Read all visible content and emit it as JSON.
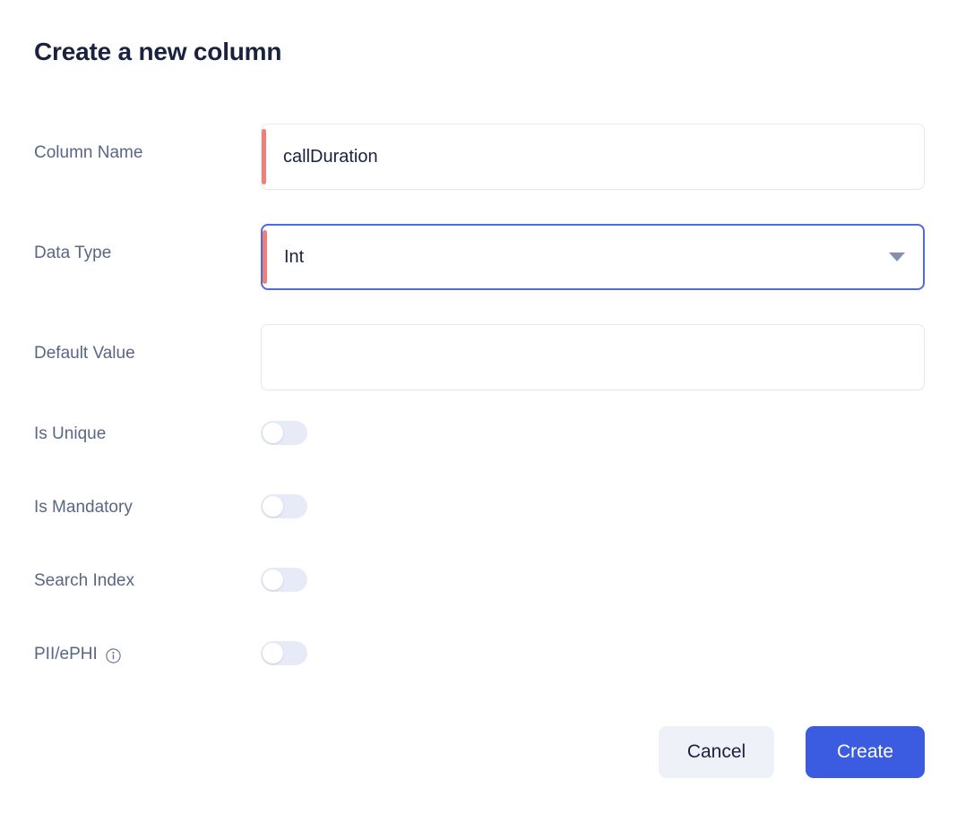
{
  "dialog": {
    "title": "Create a new column"
  },
  "fields": {
    "column_name": {
      "label": "Column Name",
      "value": "callDuration",
      "placeholder": "",
      "required": true
    },
    "data_type": {
      "label": "Data Type",
      "value": "Int",
      "required": true,
      "caret_icon": "chevron-down-icon"
    },
    "default_value": {
      "label": "Default Value",
      "value": "",
      "placeholder": "",
      "required": false
    }
  },
  "toggles": {
    "is_unique": {
      "label": "Is Unique",
      "state": "off"
    },
    "is_mandatory": {
      "label": "Is Mandatory",
      "state": "off"
    },
    "search_index": {
      "label": "Search Index",
      "state": "off"
    },
    "pii_ephi": {
      "label": "PII/ePHI",
      "state": "off",
      "info_icon": "info-icon"
    }
  },
  "footer": {
    "cancel_label": "Cancel",
    "create_label": "Create"
  },
  "colors": {
    "accent_blue": "#3b5ce0",
    "focus_blue": "#4f6ae0",
    "required_bar": "#ed8078",
    "label_text": "#5a6685",
    "title_text": "#1b2240",
    "toggle_track_off": "#e7eaf7",
    "cancel_bg": "#eef1f8"
  }
}
